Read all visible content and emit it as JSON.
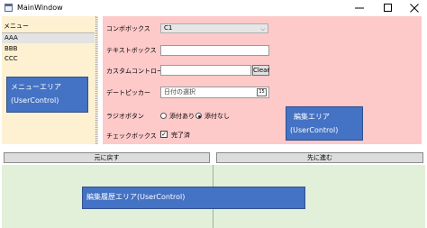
{
  "window": {
    "title": "MainWindow"
  },
  "menu": {
    "label": "メニュー",
    "items": [
      {
        "label": "AAA",
        "selected": true
      },
      {
        "label": "BBB",
        "selected": false
      },
      {
        "label": "CCC",
        "selected": false
      }
    ],
    "usercontrol_title": "メニューエリア",
    "usercontrol_sub": "(UserControl)"
  },
  "editor": {
    "combobox_label": "コンボボックス",
    "combobox_value": "C1",
    "textbox_label": "テキストボックス",
    "textbox_value": "",
    "custom_label": "カスタムコントロール",
    "custom_value": "",
    "clear_button": "Clear",
    "datepicker_label": "デートピッカー",
    "datepicker_placeholder": "日付の選択",
    "calendar_icon_text": "15",
    "radio_label": "ラジオボタン",
    "radio_options": [
      {
        "label": "添付あり",
        "checked": false
      },
      {
        "label": "添付なし",
        "checked": true
      }
    ],
    "checkbox_label": "チェックボックス",
    "checkbox_text": "完了済",
    "checkbox_checked": true,
    "usercontrol_title": "編集エリア",
    "usercontrol_sub": "(UserControl)"
  },
  "nav": {
    "back": "元に戻す",
    "forward": "先に進む"
  },
  "history": {
    "usercontrol_label": "編集履歴エリア(UserControl)"
  },
  "colors": {
    "menu_bg": "#fdf1d1",
    "edit_bg": "#fec9c9",
    "history_bg": "#e2efd9",
    "usercontrol_blue": "#4472c4"
  }
}
